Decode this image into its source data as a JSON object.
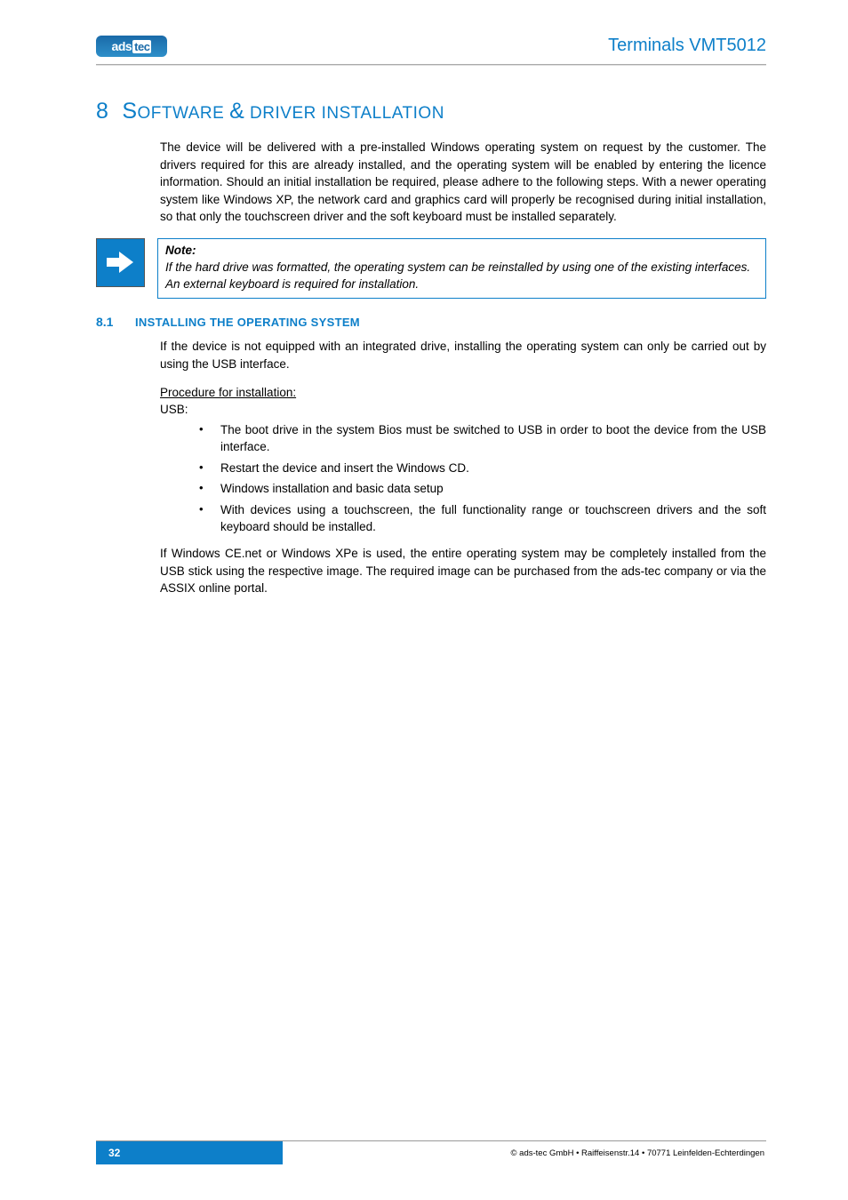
{
  "header": {
    "logo_text_a": "ads",
    "logo_text_b": "tec",
    "title": "Terminals VMT5012"
  },
  "chapter": {
    "number": "8",
    "title_big_1": "S",
    "title_small_1": "OFTWARE ",
    "title_big_2": "&",
    "title_small_2": " DRIVER INSTALLATION",
    "intro": "The device will be delivered with a pre-installed Windows operating system on request by the customer. The drivers required for this are already installed, and the operating system will be enabled by entering the licence information. Should an initial installation be required, please adhere to the following steps. With a newer operating system like Windows XP, the network card and graphics card will properly be recognised during initial installation, so that only the touchscreen driver and the soft keyboard must be installed separately."
  },
  "note": {
    "head": "Note:",
    "line1": "If the hard drive was formatted, the operating system can be reinstalled by using one of the existing interfaces.",
    "line2": "An external keyboard is required for installation."
  },
  "section": {
    "num": "8.1",
    "head": "INSTALLING THE OPERATING SYSTEM",
    "para1": "If the device is not equipped with an integrated drive, installing the operating system can only be carried out by using the USB interface.",
    "proc_head": "Procedure for installation:",
    "usb_label": "USB:",
    "bullets": [
      "The boot drive in the system Bios must be switched to USB in order to boot the device from the USB interface.",
      "Restart the device and insert the Windows CD.",
      "Windows installation and basic data setup",
      "With devices using a touchscreen, the full functionality range or touchscreen drivers and the soft keyboard should be installed."
    ],
    "para2": "If Windows CE.net or Windows XPe is used, the entire operating system may be completely installed from the USB stick using the respective image. The required image can be purchased from the ads-tec company or via the ASSIX online portal."
  },
  "footer": {
    "page": "32",
    "copyright": "© ads-tec GmbH • Raiffeisenstr.14 • 70771 Leinfelden-Echterdingen"
  }
}
